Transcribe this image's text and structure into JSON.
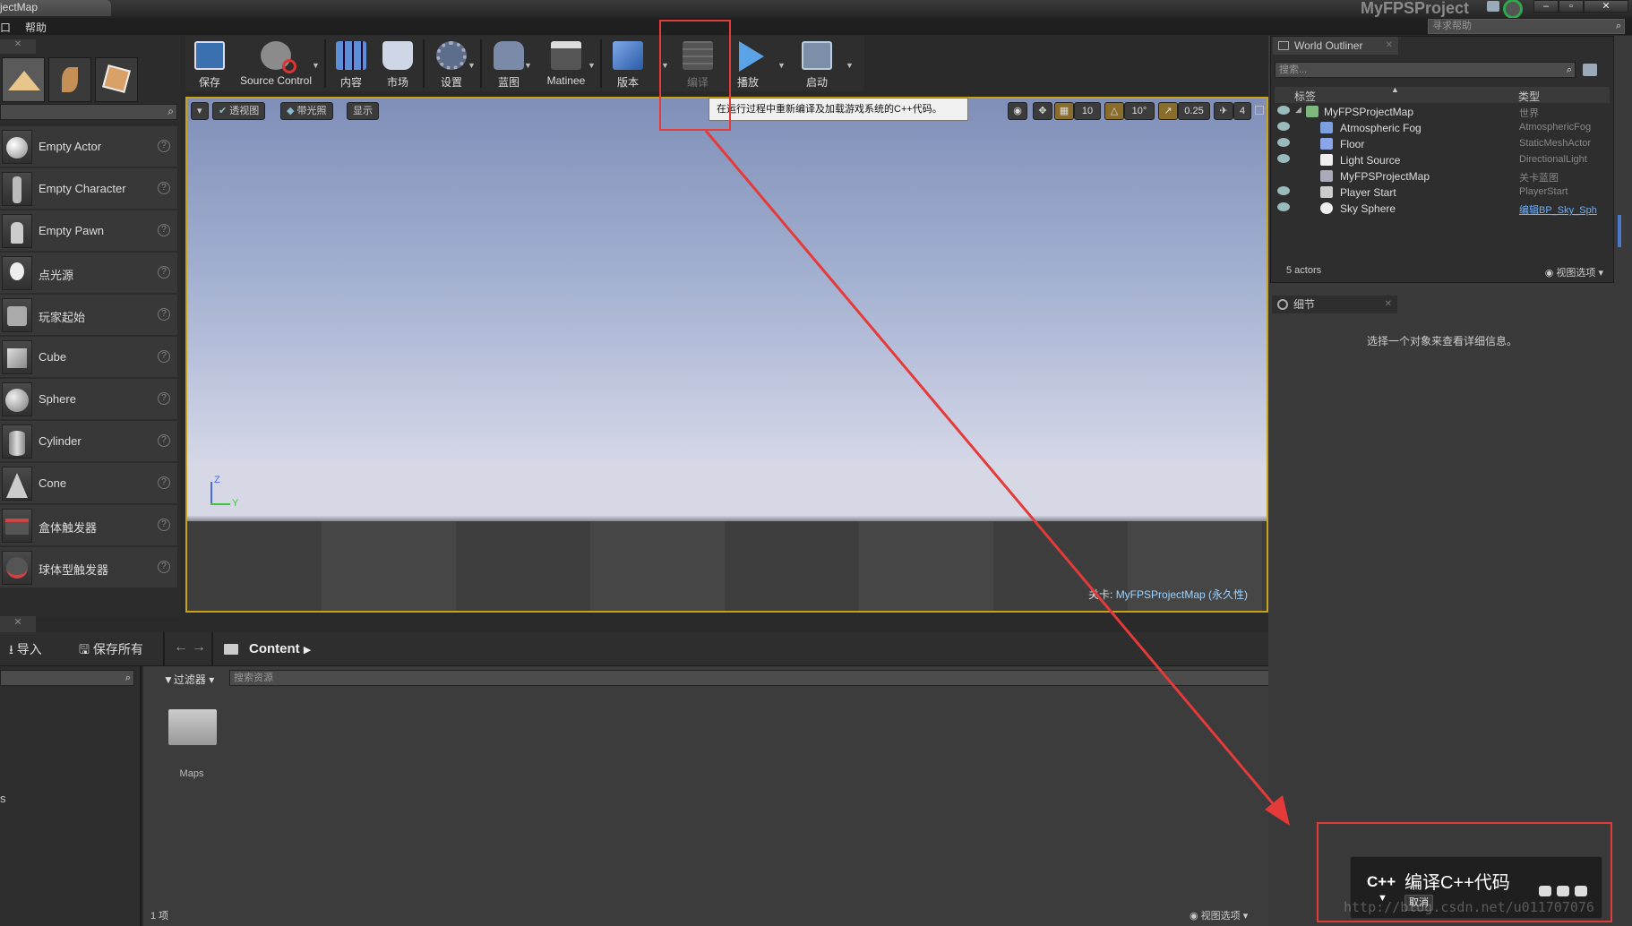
{
  "window": {
    "tab_title": "jectMap",
    "project_name": "MyFPSProject",
    "help_search_placeholder": "寻求帮助"
  },
  "menu": {
    "items": [
      "口",
      "帮助"
    ]
  },
  "modes": {
    "search_placeholder": "",
    "place_items": [
      {
        "label": "Empty Actor",
        "icon": "sphere-icon"
      },
      {
        "label": "Empty Character",
        "icon": "character-icon"
      },
      {
        "label": "Empty Pawn",
        "icon": "pawn-icon"
      },
      {
        "label": "点光源",
        "icon": "light-bulb-icon"
      },
      {
        "label": "玩家起始",
        "icon": "player-start-icon"
      },
      {
        "label": "Cube",
        "icon": "cube-icon"
      },
      {
        "label": "Sphere",
        "icon": "sphere-icon"
      },
      {
        "label": "Cylinder",
        "icon": "cylinder-icon"
      },
      {
        "label": "Cone",
        "icon": "cone-icon"
      },
      {
        "label": "盒体触发器",
        "icon": "box-trigger-icon"
      },
      {
        "label": "球体型触发器",
        "icon": "sphere-trigger-icon"
      }
    ]
  },
  "toolbar": {
    "save": "保存",
    "source_control": "Source Control",
    "content": "内容",
    "marketplace": "市场",
    "settings": "设置",
    "blueprints": "蓝图",
    "matinee": "Matinee",
    "build": "版本",
    "compile": "编译",
    "play": "播放",
    "launch": "启动"
  },
  "compile_tooltip": "在运行过程中重新编译及加载游戏系统的C++代码。",
  "viewport": {
    "perspective": "透视图",
    "lit": "带光照",
    "show": "显示",
    "grid_snap": "10",
    "rot_snap": "10°",
    "scale_snap": "0.25",
    "camera_speed": "4",
    "level_prefix": "关卡:",
    "level_name": "MyFPSProjectMap (永久性)",
    "axis_z": "Z",
    "axis_y": "Y"
  },
  "content_browser": {
    "import": "导入",
    "save_all": "保存所有",
    "path": "Content",
    "filter": "过滤器",
    "search_placeholder": "搜索资源",
    "folder_name": "Maps",
    "item_count": "1 项",
    "view_options": "视图选项",
    "left_text": "s"
  },
  "outliner": {
    "tab": "World Outliner",
    "search_placeholder": "搜索...",
    "col_label": "标签",
    "col_type": "类型",
    "rows": [
      {
        "name": "MyFPSProjectMap",
        "type": "世界",
        "indent": 0
      },
      {
        "name": "Atmospheric Fog",
        "type": "AtmosphericFog",
        "indent": 1
      },
      {
        "name": "Floor",
        "type": "StaticMeshActor",
        "indent": 1
      },
      {
        "name": "Light Source",
        "type": "DirectionalLight",
        "indent": 1
      },
      {
        "name": "MyFPSProjectMap",
        "type": "关卡蓝图",
        "indent": 1
      },
      {
        "name": "Player Start",
        "type": "PlayerStart",
        "indent": 1
      },
      {
        "name": "Sky Sphere",
        "type": "编辑BP_Sky_Sph",
        "indent": 1
      }
    ],
    "actor_count": "5 actors",
    "view_options": "视图选项"
  },
  "details": {
    "tab": "细节",
    "empty_message": "选择一个对象来查看详细信息。"
  },
  "compile_popup": {
    "title": "编译C++代码",
    "cancel": "取消",
    "logo": "C++"
  },
  "watermark": "http://blog.csdn.net/u011707076",
  "colors": {
    "annotation_red": "#e53a3a",
    "viewport_border": "#c9a21a",
    "link_blue": "#9fd3ff"
  }
}
